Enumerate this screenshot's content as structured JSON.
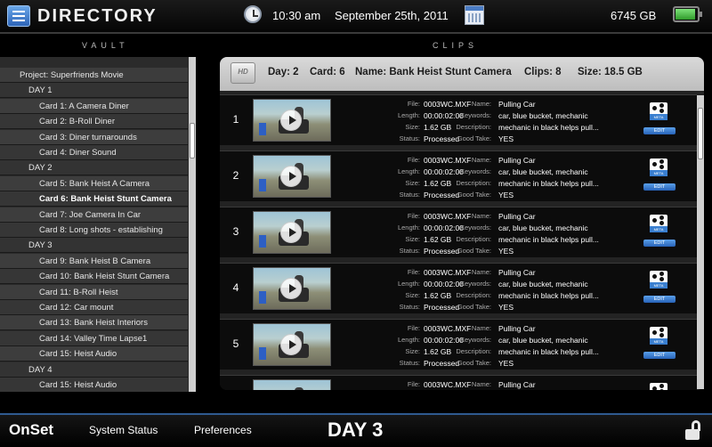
{
  "header": {
    "title": "DIRECTORY",
    "time": "10:30 am",
    "date": "September 25th, 2011",
    "storage": "6745 GB",
    "battery_level": 0.9
  },
  "sections": {
    "vault": "VAULT",
    "clips": "CLIPS"
  },
  "vault": {
    "rows": [
      {
        "type": "project",
        "label": "Project: Superfriends Movie"
      },
      {
        "type": "day",
        "label": "DAY 1"
      },
      {
        "type": "card",
        "label": "Card 1: A Camera Diner"
      },
      {
        "type": "card",
        "label": "Card 2: B-Roll Diner"
      },
      {
        "type": "card",
        "label": "Card 3: Diner turnarounds"
      },
      {
        "type": "card",
        "label": "Card 4: Diner Sound"
      },
      {
        "type": "day",
        "label": "DAY 2"
      },
      {
        "type": "card",
        "label": "Card 5: Bank Heist A Camera"
      },
      {
        "type": "card",
        "label": "Card 6: Bank Heist Stunt Camera",
        "selected": true
      },
      {
        "type": "card",
        "label": "Card 7: Joe Camera In Car"
      },
      {
        "type": "card",
        "label": "Card 8: Long shots - establishing"
      },
      {
        "type": "day",
        "label": "DAY 3"
      },
      {
        "type": "card",
        "label": "Card 9: Bank Heist B Camera"
      },
      {
        "type": "card",
        "label": "Card 10: Bank Heist Stunt Camera"
      },
      {
        "type": "card",
        "label": "Card 11: B-Roll Heist"
      },
      {
        "type": "card",
        "label": "Card 12: Car mount"
      },
      {
        "type": "card",
        "label": "Card 13: Bank Heist Interiors"
      },
      {
        "type": "card",
        "label": "Card 14: Valley Time Lapse1"
      },
      {
        "type": "card",
        "label": "Card 15: Heist Audio"
      },
      {
        "type": "day",
        "label": "DAY 4"
      },
      {
        "type": "card",
        "label": "Card 15: Heist Audio"
      }
    ]
  },
  "summary": {
    "hd_icon": "HD",
    "day": "Day: 2",
    "card": "Card: 6",
    "name": "Name: Bank Heist Stunt Camera",
    "clips": "Clips: 8",
    "size": "Size: 18.5 GB"
  },
  "field_labels": {
    "file": "File:",
    "length": "Length:",
    "size": "Size:",
    "status": "Status:",
    "name": "Name:",
    "keywords": "Keywords:",
    "description": "Description:",
    "good_take": "Good Take:"
  },
  "clip_buttons": {
    "meta": "META",
    "edit": "EDIT"
  },
  "clips": [
    {
      "num": "1",
      "file": "0003WC.MXF",
      "length": "00:00:02:00",
      "size": "1.62 GB",
      "status": "Processed",
      "name": "Pulling Car",
      "keywords": "car, blue bucket, mechanic",
      "description": "mechanic in black helps pull...",
      "good_take": "YES"
    },
    {
      "num": "2",
      "file": "0003WC.MXF",
      "length": "00:00:02:00",
      "size": "1.62 GB",
      "status": "Processed",
      "name": "Pulling Car",
      "keywords": "car, blue bucket, mechanic",
      "description": "mechanic in black helps pull...",
      "good_take": "YES"
    },
    {
      "num": "3",
      "file": "0003WC.MXF",
      "length": "00:00:02:00",
      "size": "1.62 GB",
      "status": "Processed",
      "name": "Pulling Car",
      "keywords": "car, blue bucket, mechanic",
      "description": "mechanic in black helps pull...",
      "good_take": "YES"
    },
    {
      "num": "4",
      "file": "0003WC.MXF",
      "length": "00:00:02:00",
      "size": "1.62 GB",
      "status": "Processed",
      "name": "Pulling Car",
      "keywords": "car, blue bucket, mechanic",
      "description": "mechanic in black helps pull...",
      "good_take": "YES"
    },
    {
      "num": "5",
      "file": "0003WC.MXF",
      "length": "00:00:02:00",
      "size": "1.62 GB",
      "status": "Processed",
      "name": "Pulling Car",
      "keywords": "car, blue bucket, mechanic",
      "description": "mechanic in black helps pull...",
      "good_take": "YES"
    },
    {
      "num": "",
      "file": "0003WC.MXF",
      "length": "",
      "size": "",
      "status": "",
      "name": "Pulling Car",
      "keywords": "",
      "description": "",
      "good_take": ""
    }
  ],
  "footer": {
    "brand": "OnSet",
    "system_status": "System Status",
    "preferences": "Preferences",
    "day_label": "DAY 3"
  },
  "colors": {
    "accent": "#4a86c0",
    "footer_border": "#2f5a90"
  }
}
